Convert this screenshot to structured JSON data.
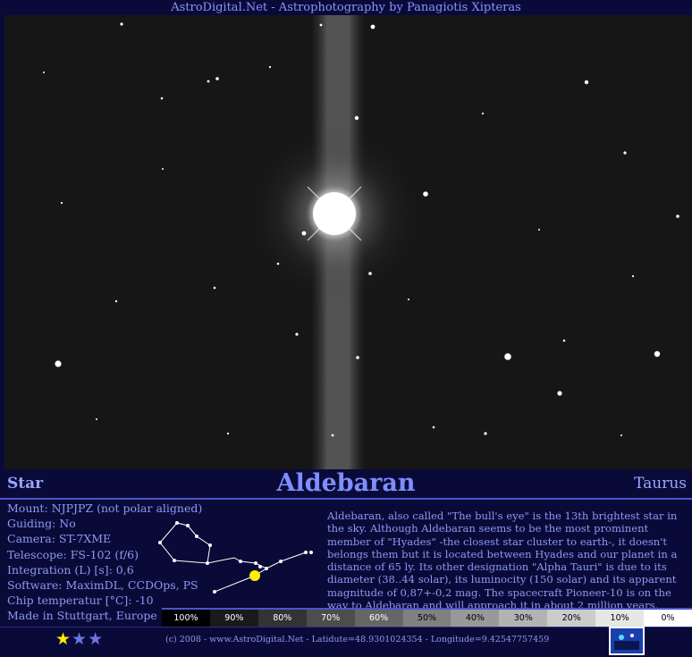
{
  "header": {
    "title": "AstroDigital.Net - Astrophotography by Panagiotis Xipteras"
  },
  "object": {
    "category": "Star",
    "name": "Aldebaran",
    "constellation": "Taurus"
  },
  "specs": [
    {
      "label": "Mount",
      "value": "NJPJPZ (not polar aligned)"
    },
    {
      "label": "Guiding",
      "value": "No"
    },
    {
      "label": "Camera",
      "value": "ST-7XME"
    },
    {
      "label": "Telescope",
      "value": "FS-102 (f/6)"
    },
    {
      "label": "Integration (L) [s]",
      "value": "0,6"
    },
    {
      "label": "Software",
      "value": "MaximDL, CCDOps, PS"
    },
    {
      "label": "Chip temperatur [°C]",
      "value": " -10"
    },
    {
      "label": "Made in Stuttgart, Europe",
      "value": ""
    }
  ],
  "description": "Aldebaran, also called \"The bull's eye\" is the 13th brightest star in the sky. Although Aldebaran seems to be the most prominent member of \"Hyades\" -the closest star cluster to earth-, it doesn't belongs them but it is located between Hyades and our planet in a distance of 65 ly. Its other designation \"Alpha Tauri\"  is due to its diameter (38..44 solar), its luminocity (150 solar) and its apparent magnitude of 0,87+-0,2 mag. The spacecraft Pioneer-10 is on the way to Aldebaran and will approach it in about 2 million years.",
  "scale": [
    {
      "label": "100%",
      "bg": "#000000",
      "fg": "#ffffff"
    },
    {
      "label": "90%",
      "bg": "#1a1a1a",
      "fg": "#ffffff"
    },
    {
      "label": "80%",
      "bg": "#333333",
      "fg": "#ffffff"
    },
    {
      "label": "70%",
      "bg": "#4d4d4d",
      "fg": "#ffffff"
    },
    {
      "label": "60%",
      "bg": "#666666",
      "fg": "#ffffff"
    },
    {
      "label": "50%",
      "bg": "#808080",
      "fg": "#000000"
    },
    {
      "label": "40%",
      "bg": "#999999",
      "fg": "#000000"
    },
    {
      "label": "30%",
      "bg": "#b3b3b3",
      "fg": "#000000"
    },
    {
      "label": "20%",
      "bg": "#cccccc",
      "fg": "#000000"
    },
    {
      "label": "10%",
      "bg": "#e6e6e6",
      "fg": "#000000"
    },
    {
      "label": "0%",
      "bg": "#ffffff",
      "fg": "#000000"
    }
  ],
  "rating": {
    "filled": 1,
    "total": 3
  },
  "footer": {
    "copyright": "(c) 2008  -  www.AstroDigital.Net  -  Latidute=48.9301024354  -  Longitude=9.42547757459"
  },
  "colors": {
    "background": "#0a0a38",
    "accent": "#7f8dff",
    "highlight": "#ffee00"
  }
}
